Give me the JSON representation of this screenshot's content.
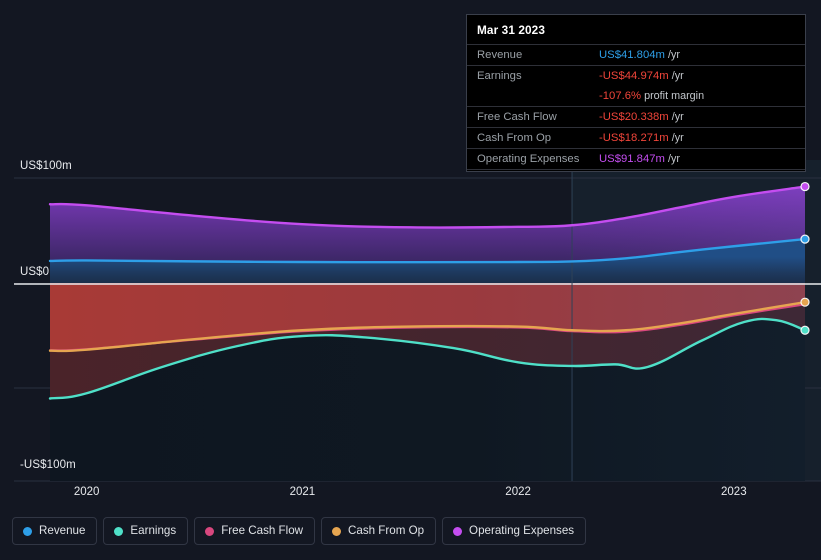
{
  "chart_data": {
    "type": "area",
    "title": "",
    "xlabel": "",
    "ylabel": "",
    "grid": true,
    "legend_position": "bottom",
    "y_ticks": [
      "US$100m",
      "US$0",
      "-US$100m"
    ],
    "y_tick_values": [
      100,
      0,
      -100
    ],
    "ylim": [
      -115,
      115
    ],
    "x_ticks": [
      "2020",
      "2021",
      "2022",
      "2023"
    ],
    "x_tick_values": [
      2020,
      2021,
      2022,
      2023
    ],
    "xlim": [
      2019.83,
      2023.33
    ],
    "units": "US$ millions per year",
    "forecast_divider_x": 2022.25,
    "series": [
      {
        "name": "Revenue",
        "color": "#2e9fe8",
        "fill": "#1e4a78",
        "points": [
          {
            "x": 2019.83,
            "y": 21.0
          },
          {
            "x": 2020.0,
            "y": 21.5
          },
          {
            "x": 2020.5,
            "y": 20.6
          },
          {
            "x": 2021.0,
            "y": 20.0
          },
          {
            "x": 2021.5,
            "y": 19.8
          },
          {
            "x": 2022.0,
            "y": 20.0
          },
          {
            "x": 2022.25,
            "y": 20.5
          },
          {
            "x": 2022.5,
            "y": 23.5
          },
          {
            "x": 2022.75,
            "y": 29.5
          },
          {
            "x": 2023.0,
            "y": 35.0
          },
          {
            "x": 2023.33,
            "y": 41.804
          }
        ],
        "endpoint_value": 41.804
      },
      {
        "name": "Earnings",
        "color": "#4fe0c8",
        "fill": "#0f1b24",
        "points": [
          {
            "x": 2019.83,
            "y": -110.0
          },
          {
            "x": 2020.0,
            "y": -105.0
          },
          {
            "x": 2020.35,
            "y": -80.0
          },
          {
            "x": 2020.7,
            "y": -60.0
          },
          {
            "x": 2021.0,
            "y": -50.5
          },
          {
            "x": 2021.3,
            "y": -52.0
          },
          {
            "x": 2021.7,
            "y": -62.0
          },
          {
            "x": 2022.0,
            "y": -75.5
          },
          {
            "x": 2022.25,
            "y": -79.0
          },
          {
            "x": 2022.45,
            "y": -77.5
          },
          {
            "x": 2022.6,
            "y": -80.0
          },
          {
            "x": 2022.85,
            "y": -55.0
          },
          {
            "x": 2023.05,
            "y": -37.0
          },
          {
            "x": 2023.2,
            "y": -35.5
          },
          {
            "x": 2023.33,
            "y": -44.974
          }
        ],
        "endpoint_value": -44.974
      },
      {
        "name": "Free Cash Flow",
        "color": "#d8477e",
        "fill": "none",
        "points": [
          {
            "x": 2019.83,
            "y": -64.0
          },
          {
            "x": 2020.0,
            "y": -63.0
          },
          {
            "x": 2020.5,
            "y": -54.0
          },
          {
            "x": 2021.0,
            "y": -46.0
          },
          {
            "x": 2021.5,
            "y": -42.5
          },
          {
            "x": 2022.0,
            "y": -42.5
          },
          {
            "x": 2022.25,
            "y": -46.0
          },
          {
            "x": 2022.5,
            "y": -46.5
          },
          {
            "x": 2022.75,
            "y": -40.0
          },
          {
            "x": 2023.0,
            "y": -31.0
          },
          {
            "x": 2023.33,
            "y": -20.338
          }
        ],
        "endpoint_value": -20.338
      },
      {
        "name": "Cash From Op",
        "color": "#e6a550",
        "fill": "#4a2230",
        "points": [
          {
            "x": 2019.83,
            "y": -64.5
          },
          {
            "x": 2020.0,
            "y": -63.5
          },
          {
            "x": 2020.5,
            "y": -53.5
          },
          {
            "x": 2021.0,
            "y": -45.0
          },
          {
            "x": 2021.5,
            "y": -41.5
          },
          {
            "x": 2022.0,
            "y": -41.5
          },
          {
            "x": 2022.25,
            "y": -45.0
          },
          {
            "x": 2022.5,
            "y": -45.0
          },
          {
            "x": 2022.75,
            "y": -38.5
          },
          {
            "x": 2023.0,
            "y": -29.5
          },
          {
            "x": 2023.33,
            "y": -18.271
          }
        ],
        "endpoint_value": -18.271
      },
      {
        "name": "Operating Expenses",
        "color": "#c44df0",
        "fill": "#3a2a5c",
        "points": [
          {
            "x": 2019.83,
            "y": 75.0
          },
          {
            "x": 2020.0,
            "y": 74.0
          },
          {
            "x": 2020.5,
            "y": 64.0
          },
          {
            "x": 2021.0,
            "y": 56.0
          },
          {
            "x": 2021.5,
            "y": 53.0
          },
          {
            "x": 2022.0,
            "y": 53.5
          },
          {
            "x": 2022.25,
            "y": 55.0
          },
          {
            "x": 2022.5,
            "y": 62.0
          },
          {
            "x": 2022.75,
            "y": 72.0
          },
          {
            "x": 2023.0,
            "y": 82.0
          },
          {
            "x": 2023.33,
            "y": 91.847
          }
        ],
        "endpoint_value": 91.847
      }
    ]
  },
  "axis": {
    "y": {
      "top_label": "US$100m",
      "zero_label": "US$0",
      "bottom_label": "-US$100m"
    },
    "x": {
      "labels": [
        "2020",
        "2021",
        "2022",
        "2023"
      ]
    }
  },
  "tooltip": {
    "date": "Mar 31 2023",
    "rows": [
      {
        "label": "Revenue",
        "amount": "US$41.804m",
        "unit": "/yr",
        "color": "#2e9fe8"
      },
      {
        "label": "Earnings",
        "amount": "-US$44.974m",
        "unit": "/yr",
        "color": "#f0453a"
      },
      {
        "label": "",
        "amount": "-107.6%",
        "unit": "profit margin",
        "color": "#f0453a"
      },
      {
        "label": "Free Cash Flow",
        "amount": "-US$20.338m",
        "unit": "/yr",
        "color": "#f0453a"
      },
      {
        "label": "Cash From Op",
        "amount": "-US$18.271m",
        "unit": "/yr",
        "color": "#f0453a"
      },
      {
        "label": "Operating Expenses",
        "amount": "US$91.847m",
        "unit": "/yr",
        "color": "#c44df0"
      }
    ]
  },
  "legend": {
    "items": [
      {
        "label": "Revenue",
        "color": "#2e9fe8"
      },
      {
        "label": "Earnings",
        "color": "#4fe0c8"
      },
      {
        "label": "Free Cash Flow",
        "color": "#d8477e"
      },
      {
        "label": "Cash From Op",
        "color": "#e6a550"
      },
      {
        "label": "Operating Expenses",
        "color": "#c44df0"
      }
    ]
  },
  "colors": {
    "background": "#131722",
    "forecast_background": "#16202c",
    "gridline": "#2a3040",
    "zero_line": "#e8eaed",
    "text": "#e8eaed",
    "muted_text": "#9aa0a6"
  }
}
